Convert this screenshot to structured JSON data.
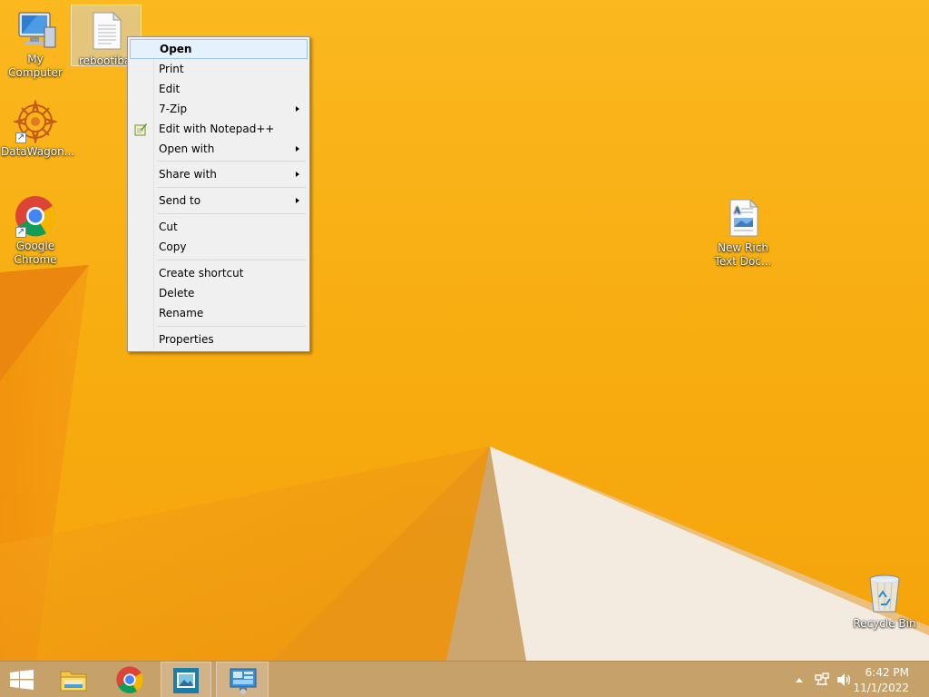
{
  "desktop_icons": [
    {
      "id": "my-computer",
      "label": "My Computer",
      "icon": "computer-icon"
    },
    {
      "id": "rebootbat",
      "label": "rebootiba",
      "icon": "text-file-icon",
      "selected": true
    },
    {
      "id": "datawagon",
      "label": "DataWagon...",
      "icon": "datawagon-icon",
      "shortcut": true
    },
    {
      "id": "chrome",
      "label": "Google\nChrome",
      "icon": "chrome-icon",
      "shortcut": true
    },
    {
      "id": "rtf",
      "label": "New Rich\nText Doc...",
      "icon": "rich-text-document-icon"
    },
    {
      "id": "recycle",
      "label": "Recycle Bin",
      "icon": "recycle-bin-icon"
    }
  ],
  "context_menu": {
    "items": [
      {
        "label": "Open",
        "default": true,
        "highlighted": true
      },
      {
        "label": "Print"
      },
      {
        "label": "Edit"
      },
      {
        "label": "7-Zip",
        "submenu": true
      },
      {
        "label": "Edit with Notepad++",
        "icon": "notepad-plus-plus-icon"
      },
      {
        "label": "Open with",
        "submenu": true
      },
      {
        "label": "Share with",
        "submenu": true
      },
      {
        "label": "Send to",
        "submenu": true
      },
      {
        "label": "Cut"
      },
      {
        "label": "Copy"
      },
      {
        "label": "Create shortcut"
      },
      {
        "label": "Delete"
      },
      {
        "label": "Rename"
      },
      {
        "label": "Properties"
      }
    ]
  },
  "taskbar": {
    "start_icon": "windows-start-icon",
    "pinned": [
      {
        "icon": "file-explorer-icon"
      },
      {
        "icon": "chrome-icon"
      },
      {
        "icon": "photos-app-icon",
        "active": true
      },
      {
        "icon": "control-panel-icon",
        "active": true
      }
    ],
    "tray": {
      "icons": [
        "show-hidden-icons-icon",
        "network-icon",
        "volume-icon"
      ],
      "time": "6:42 PM",
      "date": "11/1/2022"
    }
  },
  "colors": {
    "wallpaper": "#f7ac0f",
    "taskbar": "#c7a16a",
    "menu_highlight": "#e5f1fb"
  }
}
